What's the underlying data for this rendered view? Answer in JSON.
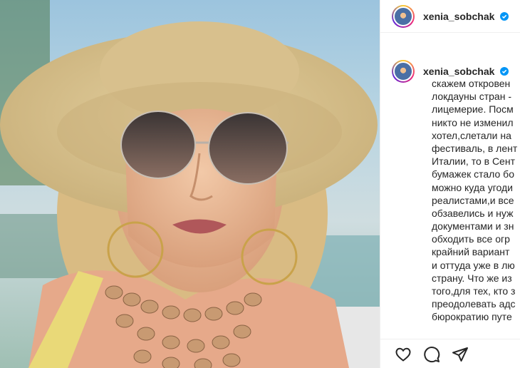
{
  "post": {
    "username": "xenia_sobchak",
    "verified_badge": "verified-badge-icon",
    "caption_lines": [
      "скажем откровен",
      "локдауны стран -",
      "лицемерие. Посм",
      "никто не изменил",
      "хотел,слетали на",
      "фестиваль, в лент",
      "Италии, то в Сент",
      "бумажек стало бо",
      "можно куда угоди",
      "реалистами,и все",
      "обзавелись и нуж",
      "документами и зн",
      "обходить все огр",
      "крайний вариант",
      "и оттуда уже в лю",
      "страну. Что же из",
      "того,для тех, кто з",
      "преодолевать адс",
      "бюрократию путе"
    ]
  },
  "actions": {
    "like_icon": "heart-icon",
    "comment_icon": "comment-icon",
    "share_icon": "share-icon"
  },
  "colors": {
    "text": "#262626",
    "verified": "#0095f6",
    "border": "#efefef"
  }
}
